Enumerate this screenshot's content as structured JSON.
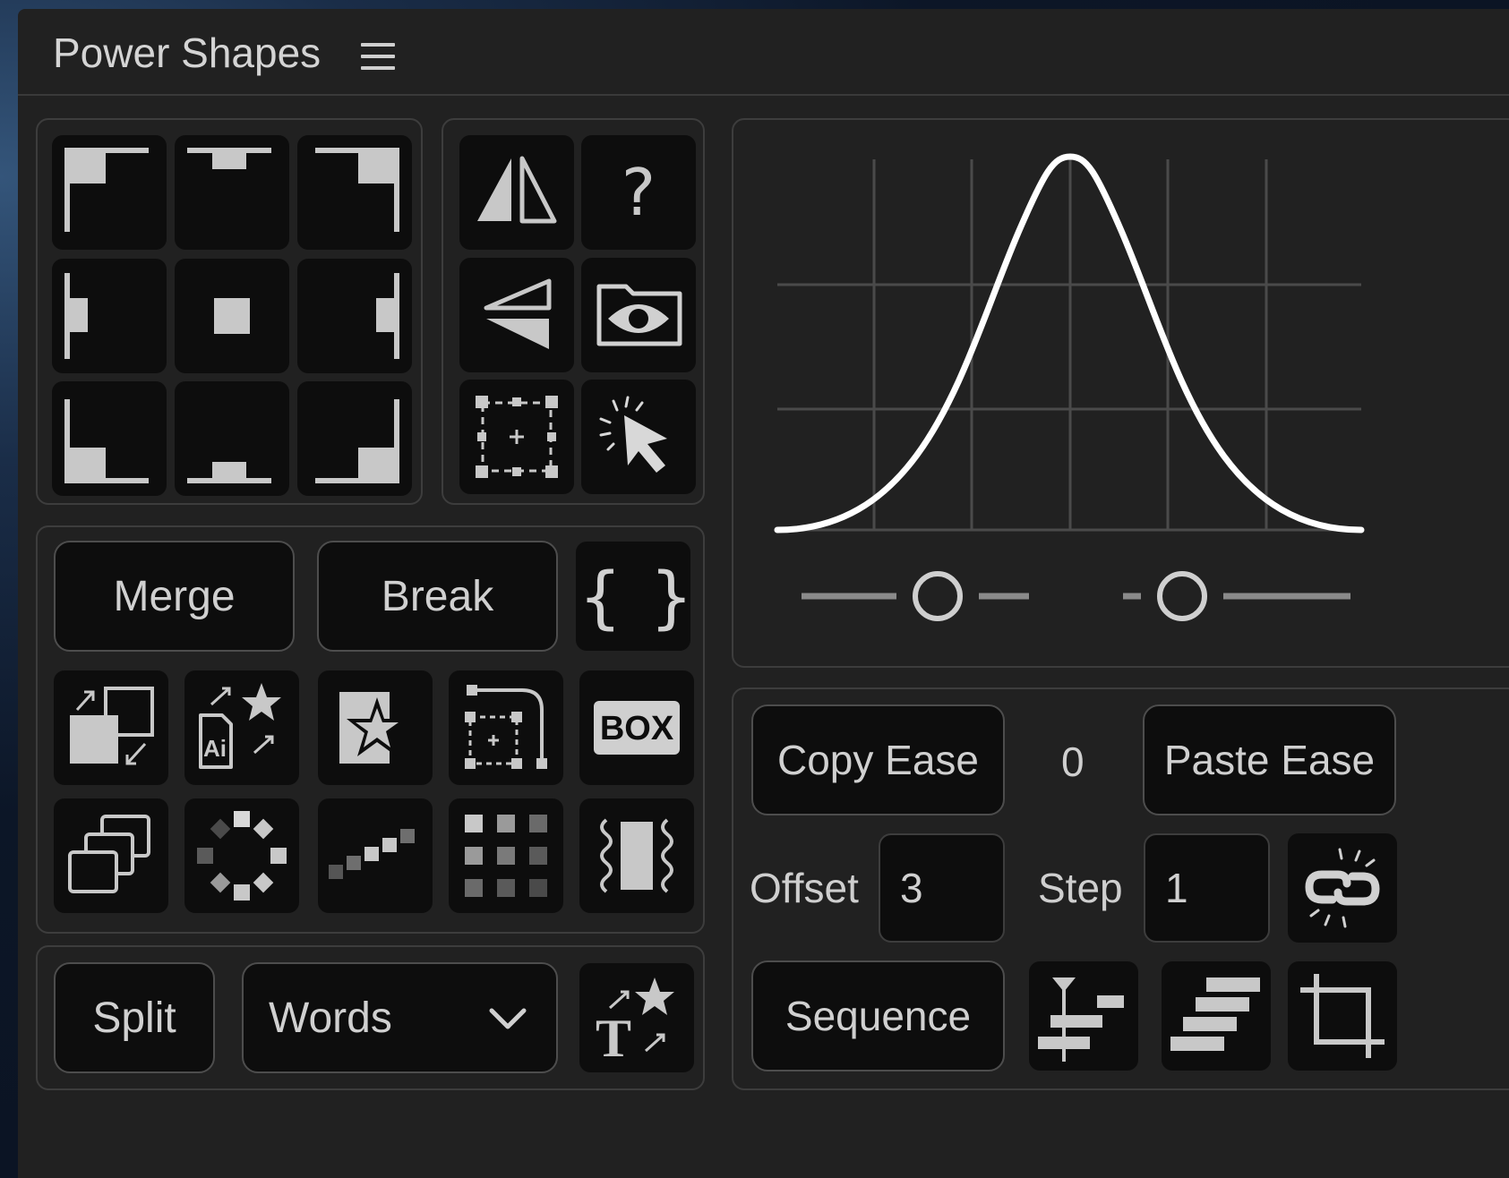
{
  "panel": {
    "title": "Power Shapes",
    "menu_icon": "hamburger-menu-icon"
  },
  "anchor_grid": {
    "icons": [
      "anchor-top-left-icon",
      "anchor-top-center-icon",
      "anchor-top-right-icon",
      "anchor-middle-left-icon",
      "anchor-center-icon",
      "anchor-middle-right-icon",
      "anchor-bottom-left-icon",
      "anchor-bottom-center-icon",
      "anchor-bottom-right-icon"
    ]
  },
  "tools": {
    "icons": [
      "flip-horizontal-icon",
      "help-icon",
      "flip-vertical-icon",
      "preview-folder-eye-icon",
      "add-bounding-box-icon",
      "select-cursor-icon"
    ],
    "help_glyph": "?"
  },
  "shape_ops": {
    "merge_label": "Merge",
    "break_label": "Break",
    "expression_glyph": "{ }",
    "box_label": "BOX",
    "icons": [
      "swap-layers-icon",
      "import-ai-shapes-icon",
      "star-card-icon",
      "path-bounding-box-icon",
      "box-text-icon",
      "duplicate-layers-icon",
      "circle-array-icon",
      "stagger-steps-icon",
      "grid-array-icon",
      "wiggle-edges-icon"
    ]
  },
  "split": {
    "split_label": "Split",
    "mode_value": "Words",
    "mode_icon": "chevron-down-icon",
    "animate_text_icon": "text-star-icon"
  },
  "ease_graph": {
    "icons": [
      "ease-curve-graph",
      "ease-slider-left",
      "ease-slider-right"
    ]
  },
  "ease_controls": {
    "copy_label": "Copy Ease",
    "paste_label": "Paste Ease",
    "value": "0",
    "offset_label": "Offset",
    "offset_value": "3",
    "step_label": "Step",
    "step_value": "1",
    "unlink_icon": "unlink-chain-icon",
    "sequence_label": "Sequence",
    "icons": [
      "align-keyframes-icon",
      "stagger-layers-icon",
      "crop-icon"
    ]
  }
}
